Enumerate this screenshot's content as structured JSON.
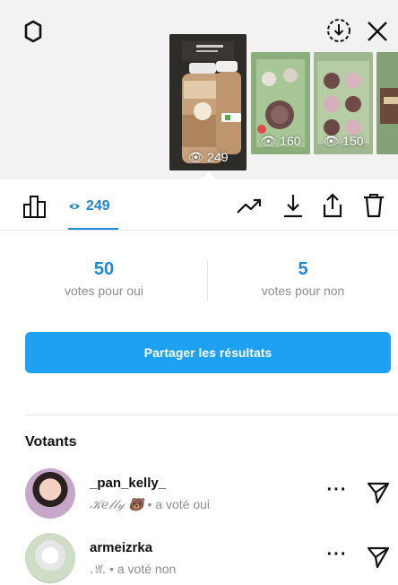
{
  "story_strip": {
    "thumbnails": [
      {
        "views": "249",
        "selected": true
      },
      {
        "views": "160",
        "selected": false
      },
      {
        "views": "150",
        "selected": false
      },
      {
        "views": "",
        "selected": false
      }
    ]
  },
  "action_bar": {
    "viewer_count": "249",
    "icons": [
      "insights-icon",
      "eye-icon",
      "trend-icon",
      "download-icon",
      "share-icon",
      "trash-icon"
    ]
  },
  "poll_results": {
    "yes": {
      "count": "50",
      "label": "votes pour oui"
    },
    "no": {
      "count": "5",
      "label": "votes pour non"
    }
  },
  "share_button": {
    "label": "Partager les résultats"
  },
  "voters": {
    "title": "Votants",
    "items": [
      {
        "username": "_pan_kelly_",
        "display": "𝒦𝑒𝓁𝓁𝓎 🐻",
        "status": "a voté oui"
      },
      {
        "username": "armeizrka",
        "display": ".𝔄.",
        "status": "a voté non"
      }
    ]
  },
  "colors": {
    "accent": "#1e88d8",
    "button": "#1ea1f2",
    "muted": "#8e8e8e"
  }
}
